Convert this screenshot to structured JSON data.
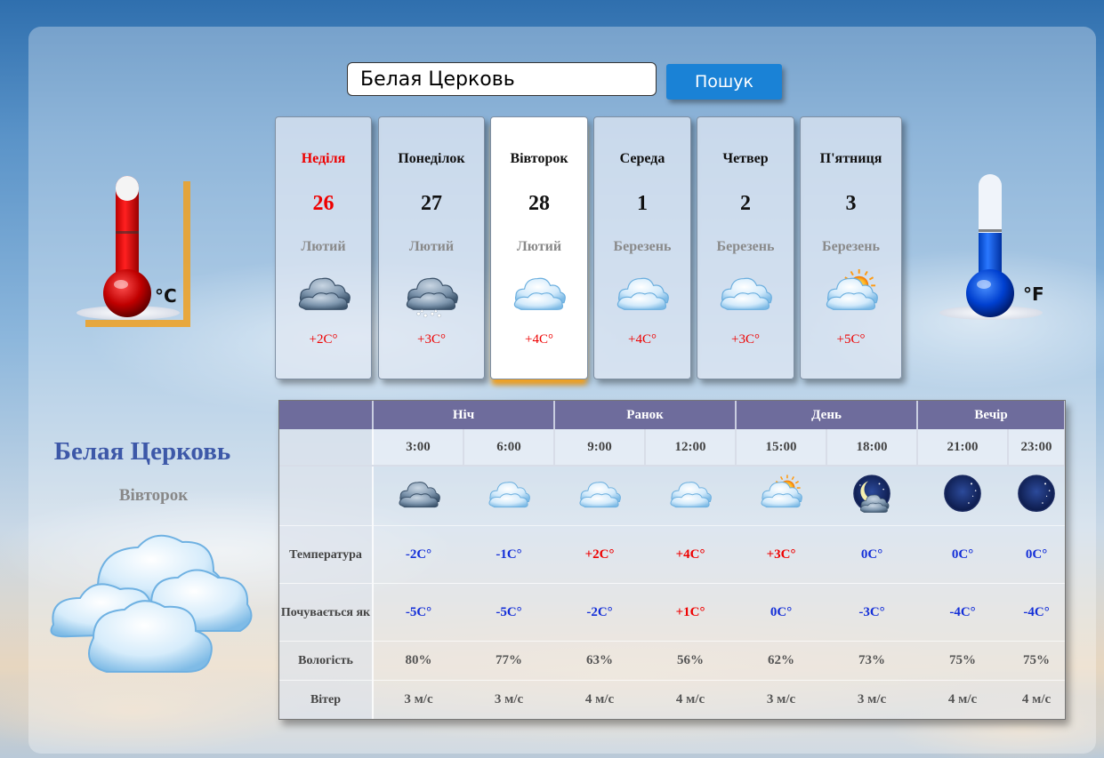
{
  "search": {
    "value": "Белая Церковь",
    "button_label": "Пошук"
  },
  "units": {
    "celsius": "°C",
    "fahrenheit": "°F"
  },
  "days": [
    {
      "name": "Неділя",
      "num": "26",
      "month": "Лютий",
      "temp": "+2C°",
      "icon": "cloud-dark-icon",
      "active": false,
      "sunday": true
    },
    {
      "name": "Понеділок",
      "num": "27",
      "month": "Лютий",
      "temp": "+3C°",
      "icon": "cloud-snow-icon",
      "active": false,
      "sunday": false
    },
    {
      "name": "Вівторок",
      "num": "28",
      "month": "Лютий",
      "temp": "+4C°",
      "icon": "cloud-light-icon",
      "active": true,
      "sunday": false
    },
    {
      "name": "Середа",
      "num": "1",
      "month": "Березень",
      "temp": "+4C°",
      "icon": "cloud-light-icon",
      "active": false,
      "sunday": false
    },
    {
      "name": "Четвер",
      "num": "2",
      "month": "Березень",
      "temp": "+3C°",
      "icon": "cloud-light-icon",
      "active": false,
      "sunday": false
    },
    {
      "name": "П'ятниця",
      "num": "3",
      "month": "Березень",
      "temp": "+5C°",
      "icon": "sun-cloud-icon",
      "active": false,
      "sunday": false
    }
  ],
  "selected": {
    "city": "Белая Церковь",
    "day": "Вівторок",
    "icon": "big-cloud-icon"
  },
  "table": {
    "periods": [
      "Ніч",
      "Ранок",
      "День",
      "Вечір"
    ],
    "times": [
      "3:00",
      "6:00",
      "9:00",
      "12:00",
      "15:00",
      "18:00",
      "21:00",
      "23:00"
    ],
    "icons": [
      "cloud-dark-icon",
      "cloud-light-icon",
      "cloud-light-icon",
      "cloud-light-icon",
      "sun-cloud-icon",
      "moon-cloud-icon",
      "moon-icon",
      "moon-icon"
    ],
    "labels": {
      "temp": "Температура",
      "feel": "Почувається як",
      "humidity": "Вологість",
      "wind": "Вітер"
    },
    "temp": [
      "-2C°",
      "-1C°",
      "+2C°",
      "+4C°",
      "+3C°",
      "0C°",
      "0C°",
      "0C°"
    ],
    "feel": [
      "-5C°",
      "-5C°",
      "-2C°",
      "+1C°",
      "0C°",
      "-3C°",
      "-4C°",
      "-4C°"
    ],
    "humidity": [
      "80%",
      "77%",
      "63%",
      "56%",
      "62%",
      "73%",
      "75%",
      "75%"
    ],
    "wind": [
      "3 м/с",
      "3 м/с",
      "4 м/с",
      "4 м/с",
      "3 м/с",
      "3 м/с",
      "4 м/с",
      "4 м/с"
    ]
  },
  "colors": {
    "positive": "#e00000",
    "negative": "#1530d8",
    "header": "#6e6c9c",
    "accent": "#1a82d6",
    "active_glow": "#f0a020"
  }
}
